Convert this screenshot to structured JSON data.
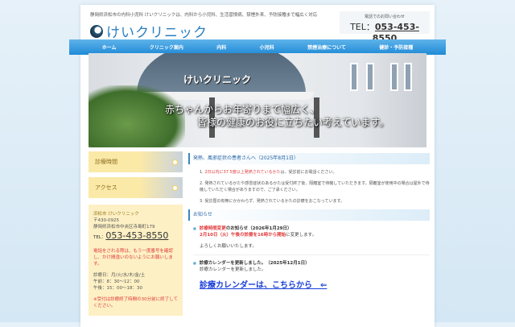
{
  "header": {
    "tagline": "静岡県浜松市の内科小児科 けいクリニックは、内科から小児科、生活習慣病、禁煙外来、予防接種まで幅広く対応",
    "logo_text": "けいクリニック",
    "tel_caption": "電話でのお問い合わせ",
    "tel_prefix": "TEL：",
    "tel_number": "053-453-8550"
  },
  "nav": [
    "ホーム",
    "クリニック案内",
    "内科",
    "小児科",
    "禁煙治療について",
    "健診・予防接種"
  ],
  "hero": {
    "sign": "けいクリニック",
    "line1": "赤ちゃんからお年寄りまで幅広く、",
    "line2": "皆様の健康のお役に立ちたい考えています。"
  },
  "sidebar": {
    "hours_button": "診療時間",
    "access_button": "アクセス",
    "clinic_name": "浜松市 けいクリニック",
    "postal": "〒430-0925",
    "address": "静岡県浜松市中央区寺島町179",
    "tel_label": "TEL：",
    "tel": "053-453-8550",
    "notice": "電話をされる際は、もう一度番号を確認し、かけ間違いのないようにお願いします。",
    "days": "診療日：月/火/水/木/金/土",
    "am": "午前：8：30〜12：00",
    "pm": "午後：15：00〜18：30",
    "reception": "※受付は診療終了時間の30分前に終了してください。"
  },
  "fever": {
    "title": "発熱、風邪症状の患者さんへ（2025年8月1日）",
    "items": [
      {
        "num": "1.",
        "red": "2日以内に37.5度以上発熱されているかた",
        "rest": "は、受診前にお電話ください。"
      },
      {
        "num": "2.",
        "red": "",
        "rest": "発熱されているかたや感冒症状のあるかたは受付終了後、隔離室で待機していただきます。隔離室が使用中の場合は屋外で待機していただく場合がありますので、ご了承ください。"
      },
      {
        "num": "3.",
        "red": "",
        "rest": "受診歴の有無にかかわらず、発熱されているかたの診療をおこなっています。"
      }
    ]
  },
  "news": {
    "title": "お知らせ",
    "item1": {
      "red_title": "診療時間変更",
      "title_rest": "のお知らせ（2026年1月29日）",
      "red_body": "2月10日（火）午後の診療を16時から開始",
      "body_rest": "に変更します。",
      "closing": "よろしくお願いいたします。"
    },
    "item2": {
      "title": "診療カレンダーを更新しました。（2025年12月1日）",
      "body": "診療カレンダーを更新しました。"
    },
    "calendar_link": "診療カレンダーは、こちらから　⇐"
  }
}
